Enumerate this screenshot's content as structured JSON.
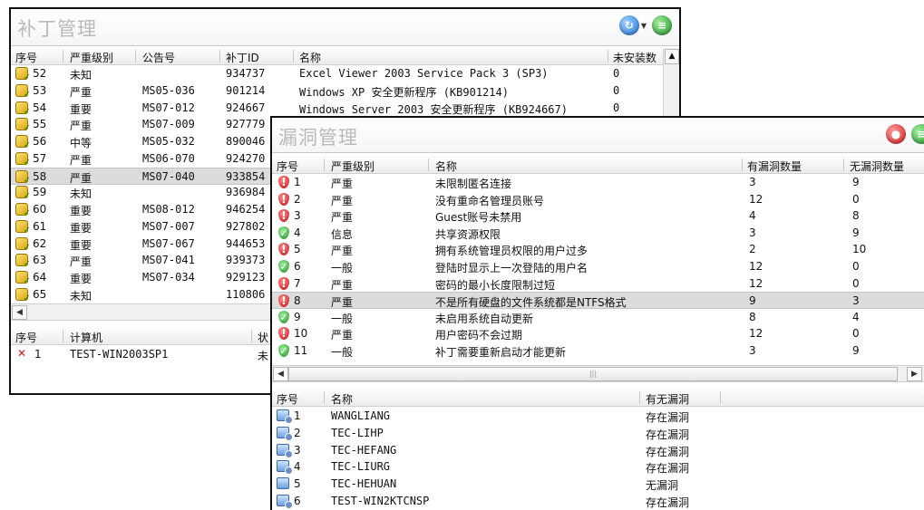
{
  "patch_window": {
    "title": "补丁管理",
    "columns": [
      "序号",
      "严重级别",
      "公告号",
      "补丁ID",
      "名称",
      "未安装数"
    ],
    "rows": [
      {
        "id": "52",
        "severity": "未知",
        "bulletin": "",
        "patch_id": "934737",
        "name": "Excel Viewer 2003 Service Pack 3 (SP3)",
        "count": "0"
      },
      {
        "id": "53",
        "severity": "严重",
        "bulletin": "MS05-036",
        "patch_id": "901214",
        "name": "Windows XP 安全更新程序 (KB901214)",
        "count": "0"
      },
      {
        "id": "54",
        "severity": "重要",
        "bulletin": "MS07-012",
        "patch_id": "924667",
        "name": "Windows Server 2003 安全更新程序 (KB924667)",
        "count": "0"
      },
      {
        "id": "55",
        "severity": "严重",
        "bulletin": "MS07-009",
        "patch_id": "927779",
        "name": "",
        "count": ""
      },
      {
        "id": "56",
        "severity": "中等",
        "bulletin": "MS05-032",
        "patch_id": "890046",
        "name": "",
        "count": ""
      },
      {
        "id": "57",
        "severity": "严重",
        "bulletin": "MS06-070",
        "patch_id": "924270",
        "name": "",
        "count": ""
      },
      {
        "id": "58",
        "severity": "严重",
        "bulletin": "MS07-040",
        "patch_id": "933854",
        "name": "",
        "count": ""
      },
      {
        "id": "59",
        "severity": "未知",
        "bulletin": "",
        "patch_id": "936984",
        "name": "",
        "count": ""
      },
      {
        "id": "60",
        "severity": "重要",
        "bulletin": "MS08-012",
        "patch_id": "946254",
        "name": "",
        "count": ""
      },
      {
        "id": "61",
        "severity": "重要",
        "bulletin": "MS07-007",
        "patch_id": "927802",
        "name": "",
        "count": ""
      },
      {
        "id": "62",
        "severity": "重要",
        "bulletin": "MS07-067",
        "patch_id": "944653",
        "name": "",
        "count": ""
      },
      {
        "id": "63",
        "severity": "严重",
        "bulletin": "MS07-041",
        "patch_id": "939373",
        "name": "",
        "count": ""
      },
      {
        "id": "64",
        "severity": "重要",
        "bulletin": "MS07-034",
        "patch_id": "929123",
        "name": "",
        "count": ""
      },
      {
        "id": "65",
        "severity": "未知",
        "bulletin": "",
        "patch_id": "110806",
        "name": "",
        "count": ""
      }
    ],
    "bottom_columns": [
      "序号",
      "计算机",
      "状"
    ],
    "bottom_rows": [
      {
        "id": "1",
        "computer": "TEST-WIN2003SP1",
        "status": "未"
      }
    ]
  },
  "vuln_window": {
    "title": "漏洞管理",
    "columns": [
      "序号",
      "严重级别",
      "名称",
      "有漏洞数量",
      "无漏洞数量"
    ],
    "rows": [
      {
        "id": "1",
        "severity": "严重",
        "name": "未限制匿名连接",
        "vuln": "3",
        "novuln": "9",
        "icon": "red"
      },
      {
        "id": "2",
        "severity": "严重",
        "name": "没有重命名管理员账号",
        "vuln": "12",
        "novuln": "0",
        "icon": "red"
      },
      {
        "id": "3",
        "severity": "严重",
        "name": "Guest账号未禁用",
        "vuln": "4",
        "novuln": "8",
        "icon": "red"
      },
      {
        "id": "4",
        "severity": "信息",
        "name": "共享资源权限",
        "vuln": "3",
        "novuln": "9",
        "icon": "green"
      },
      {
        "id": "5",
        "severity": "严重",
        "name": "拥有系统管理员权限的用户过多",
        "vuln": "2",
        "novuln": "10",
        "icon": "red"
      },
      {
        "id": "6",
        "severity": "一般",
        "name": "登陆时显示上一次登陆的用户名",
        "vuln": "12",
        "novuln": "0",
        "icon": "green"
      },
      {
        "id": "7",
        "severity": "严重",
        "name": "密码的最小长度限制过短",
        "vuln": "12",
        "novuln": "0",
        "icon": "red"
      },
      {
        "id": "8",
        "severity": "严重",
        "name": "不是所有硬盘的文件系统都是NTFS格式",
        "vuln": "9",
        "novuln": "3",
        "icon": "red"
      },
      {
        "id": "9",
        "severity": "一般",
        "name": "未启用系统自动更新",
        "vuln": "8",
        "novuln": "4",
        "icon": "green"
      },
      {
        "id": "10",
        "severity": "严重",
        "name": "用户密码不会过期",
        "vuln": "12",
        "novuln": "0",
        "icon": "red"
      },
      {
        "id": "11",
        "severity": "一般",
        "name": "补丁需要重新启动才能更新",
        "vuln": "3",
        "novuln": "9",
        "icon": "green"
      }
    ],
    "bottom_columns": [
      "序号",
      "名称",
      "有无漏洞"
    ],
    "bottom_rows": [
      {
        "id": "1",
        "name": "WANGLIANG",
        "status": "存在漏洞",
        "warn": true
      },
      {
        "id": "2",
        "name": "TEC-LIHP",
        "status": "存在漏洞",
        "warn": true
      },
      {
        "id": "3",
        "name": "TEC-HEFANG",
        "status": "存在漏洞",
        "warn": true
      },
      {
        "id": "4",
        "name": "TEC-LIURG",
        "status": "存在漏洞",
        "warn": true
      },
      {
        "id": "5",
        "name": "TEC-HEHUAN",
        "status": "无漏洞",
        "warn": false
      },
      {
        "id": "6",
        "name": "TEST-WIN2KTCNSP",
        "status": "存在漏洞",
        "warn": true
      }
    ]
  },
  "icons": {
    "refresh": "refresh-icon",
    "export": "export-icon",
    "close": "close-icon",
    "key_ok": "key-check-icon",
    "shield_red": "red-shield-icon",
    "shield_green": "green-shield-icon",
    "computer": "computer-icon",
    "error": "red-x-icon"
  },
  "colors": {
    "selection": "#dcdcdc",
    "title_text": "#b9b9b9",
    "critical": "#c01010",
    "ok": "#1d8d1d"
  }
}
